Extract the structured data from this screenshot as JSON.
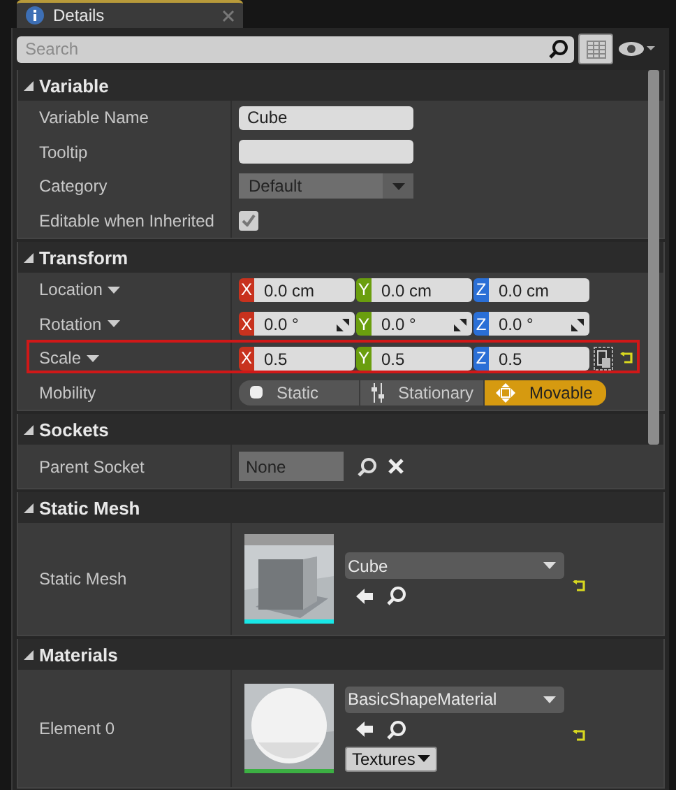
{
  "tab": {
    "label": "Details"
  },
  "search": {
    "placeholder": "Search"
  },
  "sections": [
    {
      "title": "Variable",
      "expanded": true,
      "rows": [
        {
          "kind": "text",
          "label": "Variable Name",
          "value": "Cube"
        },
        {
          "kind": "text",
          "label": "Tooltip"
        },
        {
          "kind": "dropdown",
          "label": "Category",
          "value": "Default"
        },
        {
          "kind": "checkbox",
          "label": "Editable when Inherited",
          "checked": true
        }
      ]
    },
    {
      "title": "Transform",
      "expanded": true,
      "rows": [
        {
          "kind": "vector",
          "label": "Location",
          "highlighted": false,
          "spin_handles": false,
          "lock": false,
          "reset": false,
          "fields": [
            {
              "axis": "X",
              "color": "#c8321e",
              "value": "0.0 cm"
            },
            {
              "axis": "Y",
              "color": "#6a9e0e",
              "value": "0.0 cm"
            },
            {
              "axis": "Z",
              "color": "#2a6fd6",
              "value": "0.0 cm"
            }
          ]
        },
        {
          "kind": "vector",
          "label": "Rotation",
          "highlighted": false,
          "spin_handles": true,
          "lock": false,
          "reset": false,
          "fields": [
            {
              "axis": "X",
              "color": "#c8321e",
              "value": "0.0 °"
            },
            {
              "axis": "Y",
              "color": "#6a9e0e",
              "value": "0.0 °"
            },
            {
              "axis": "Z",
              "color": "#2a6fd6",
              "value": "0.0 °"
            }
          ]
        },
        {
          "kind": "vector",
          "label": "Scale",
          "highlighted": true,
          "spin_handles": false,
          "lock": true,
          "reset": true,
          "fields": [
            {
              "axis": "X",
              "color": "#c8321e",
              "value": "0.5"
            },
            {
              "axis": "Y",
              "color": "#6a9e0e",
              "value": "0.5"
            },
            {
              "axis": "Z",
              "color": "#2a6fd6",
              "value": "0.5"
            }
          ]
        },
        {
          "kind": "mobility",
          "label": "Mobility",
          "options": [
            {
              "kind": "static",
              "label": "Static",
              "selected": false
            },
            {
              "kind": "stationary",
              "label": "Stationary",
              "selected": false
            },
            {
              "kind": "movable",
              "label": "Movable",
              "selected": true
            }
          ]
        }
      ]
    },
    {
      "title": "Sockets",
      "expanded": true,
      "rows": [
        {
          "kind": "socket",
          "label": "Parent Socket",
          "value": "None"
        }
      ]
    },
    {
      "title": "Static Mesh",
      "expanded": true,
      "rows": [
        {
          "kind": "mesh",
          "label": "Static Mesh",
          "color": "#19e6e6",
          "value": "Cube",
          "reset": true
        }
      ]
    },
    {
      "title": "Materials",
      "expanded": true,
      "rows": [
        {
          "kind": "material",
          "label": "Element 0",
          "color": "#3cb043",
          "value": "BasicShapeMaterial",
          "textures": "Textures",
          "reset": true
        }
      ]
    }
  ]
}
